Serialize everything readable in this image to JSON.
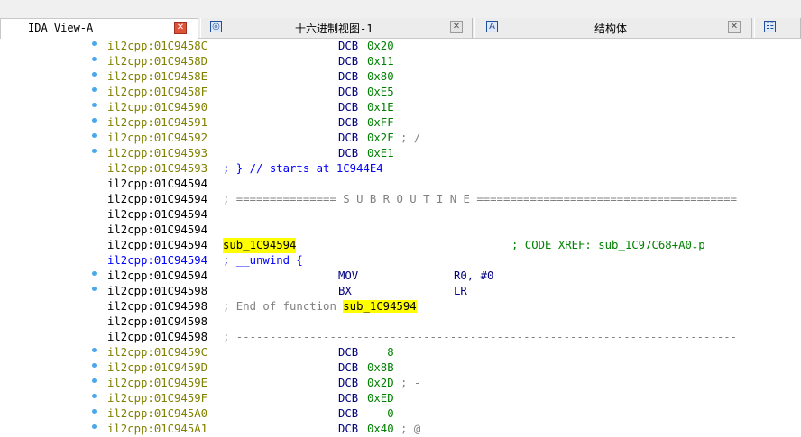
{
  "tabs": [
    {
      "label": "IDA View-A",
      "active": true
    },
    {
      "label": "十六进制视图-1",
      "icon": "hex-view-icon"
    },
    {
      "label": "结构体",
      "icon": "structures-icon"
    },
    {
      "icon": "enums-icon"
    }
  ],
  "lines": [
    {
      "addr": "il2cpp:01C9458C",
      "dot": true,
      "addrColor": "olive",
      "mnem": "DCB",
      "op": "0x20"
    },
    {
      "addr": "il2cpp:01C9458D",
      "dot": true,
      "addrColor": "olive",
      "mnem": "DCB",
      "op": "0x11"
    },
    {
      "addr": "il2cpp:01C9458E",
      "dot": true,
      "addrColor": "olive",
      "mnem": "DCB",
      "op": "0x80"
    },
    {
      "addr": "il2cpp:01C9458F",
      "dot": true,
      "addrColor": "olive",
      "mnem": "DCB",
      "op": "0xE5"
    },
    {
      "addr": "il2cpp:01C94590",
      "dot": true,
      "addrColor": "olive",
      "mnem": "DCB",
      "op": "0x1E"
    },
    {
      "addr": "il2cpp:01C94591",
      "dot": true,
      "addrColor": "olive",
      "mnem": "DCB",
      "op": "0xFF"
    },
    {
      "addr": "il2cpp:01C94592",
      "dot": true,
      "addrColor": "olive",
      "mnem": "DCB",
      "op": "0x2F",
      "cmt": " ; /"
    },
    {
      "addr": "il2cpp:01C94593",
      "dot": true,
      "addrColor": "olive",
      "mnem": "DCB",
      "op": "0xE1"
    },
    {
      "addr": "il2cpp:01C94593",
      "addrColor": "olive",
      "text": "; } // starts at 1C944E4",
      "textColor": "blue"
    },
    {
      "addr": "il2cpp:01C94594",
      "addrColor": "black"
    },
    {
      "addr": "il2cpp:01C94594",
      "addrColor": "black",
      "sep": "; =============== S U B R O U T I N E ======================================="
    },
    {
      "addr": "il2cpp:01C94594",
      "addrColor": "black"
    },
    {
      "addr": "il2cpp:01C94594",
      "addrColor": "black"
    },
    {
      "addr": "il2cpp:01C94594",
      "addrColor": "black",
      "label": "sub_1C94594",
      "xref": "; CODE XREF: sub_1C97C68+A0↓p"
    },
    {
      "addr": "il2cpp:01C94594",
      "addrColor": "blue",
      "text": "; __unwind {",
      "textColor": "blue"
    },
    {
      "addr": "il2cpp:01C94594",
      "dot": true,
      "addrColor": "black",
      "mnem": "MOV",
      "op2": "R0, #0"
    },
    {
      "addr": "il2cpp:01C94598",
      "dot": true,
      "addrColor": "black",
      "mnem": "BX",
      "op2": "LR"
    },
    {
      "addr": "il2cpp:01C94598",
      "addrColor": "black",
      "endfunc": "; End of function ",
      "endfuncName": "sub_1C94594"
    },
    {
      "addr": "il2cpp:01C94598",
      "addrColor": "black"
    },
    {
      "addr": "il2cpp:01C94598",
      "addrColor": "black",
      "sep": "; ---------------------------------------------------------------------------"
    },
    {
      "addr": "il2cpp:01C9459C",
      "dot": true,
      "addrColor": "olive",
      "mnem": "DCB",
      "op": "   8"
    },
    {
      "addr": "il2cpp:01C9459D",
      "dot": true,
      "addrColor": "olive",
      "mnem": "DCB",
      "op": "0x8B"
    },
    {
      "addr": "il2cpp:01C9459E",
      "dot": true,
      "addrColor": "olive",
      "mnem": "DCB",
      "op": "0x2D",
      "cmt": " ; -"
    },
    {
      "addr": "il2cpp:01C9459F",
      "dot": true,
      "addrColor": "olive",
      "mnem": "DCB",
      "op": "0xED"
    },
    {
      "addr": "il2cpp:01C945A0",
      "dot": true,
      "addrColor": "olive",
      "mnem": "DCB",
      "op": "   0"
    },
    {
      "addr": "il2cpp:01C945A1",
      "dot": true,
      "addrColor": "olive",
      "mnem": "DCB",
      "op": "0x40",
      "cmt": " ; @"
    }
  ]
}
